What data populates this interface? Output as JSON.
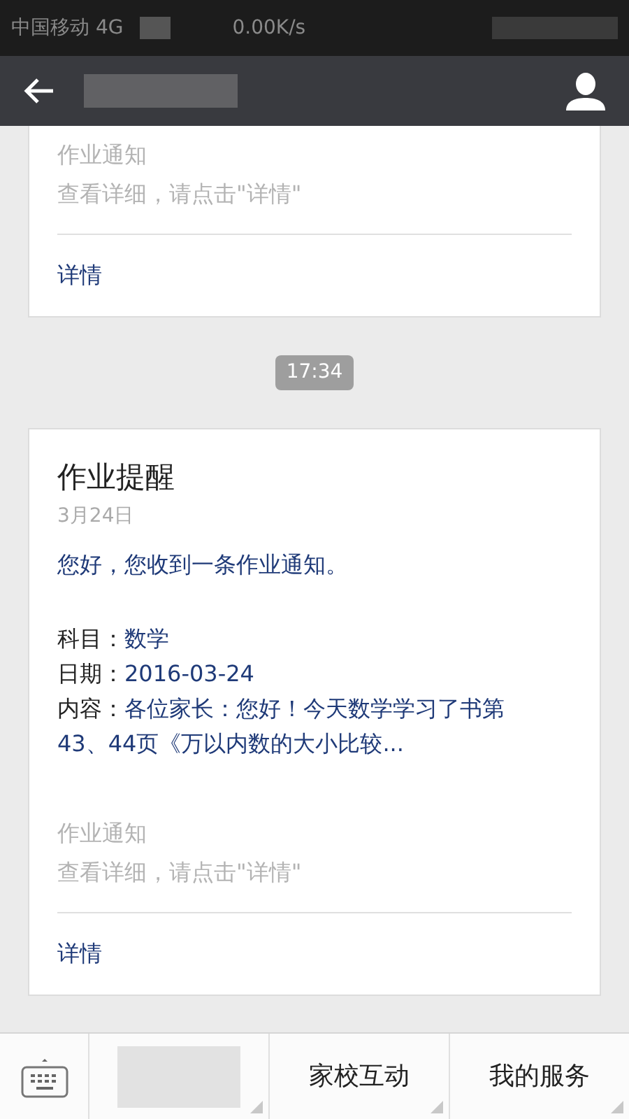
{
  "status_bar": {
    "carrier": "中国移动 4G",
    "speed": "0.00K/s"
  },
  "cards": [
    {
      "footer_label": "作业通知",
      "footer_hint": "查看详细，请点击\"详情\"",
      "link": "详情"
    },
    {
      "timestamp": "17:34",
      "title": "作业提醒",
      "date": "3月24日",
      "greeting": "您好，您收到一条作业通知。",
      "fields": [
        {
          "label": "科目：",
          "value": "数学"
        },
        {
          "label": "日期：",
          "value": "2016-03-24"
        },
        {
          "label": "内容：",
          "value": "各位家长：您好！今天数学学习了书第43、44页《万以内数的大小比较..."
        }
      ],
      "footer_label": "作业通知",
      "footer_hint": "查看详细，请点击\"详情\"",
      "link": "详情"
    }
  ],
  "bottom_menu": [
    {
      "kind": "blurred"
    },
    {
      "kind": "text",
      "label": "家校互动"
    },
    {
      "kind": "text",
      "label": "我的服务"
    }
  ]
}
